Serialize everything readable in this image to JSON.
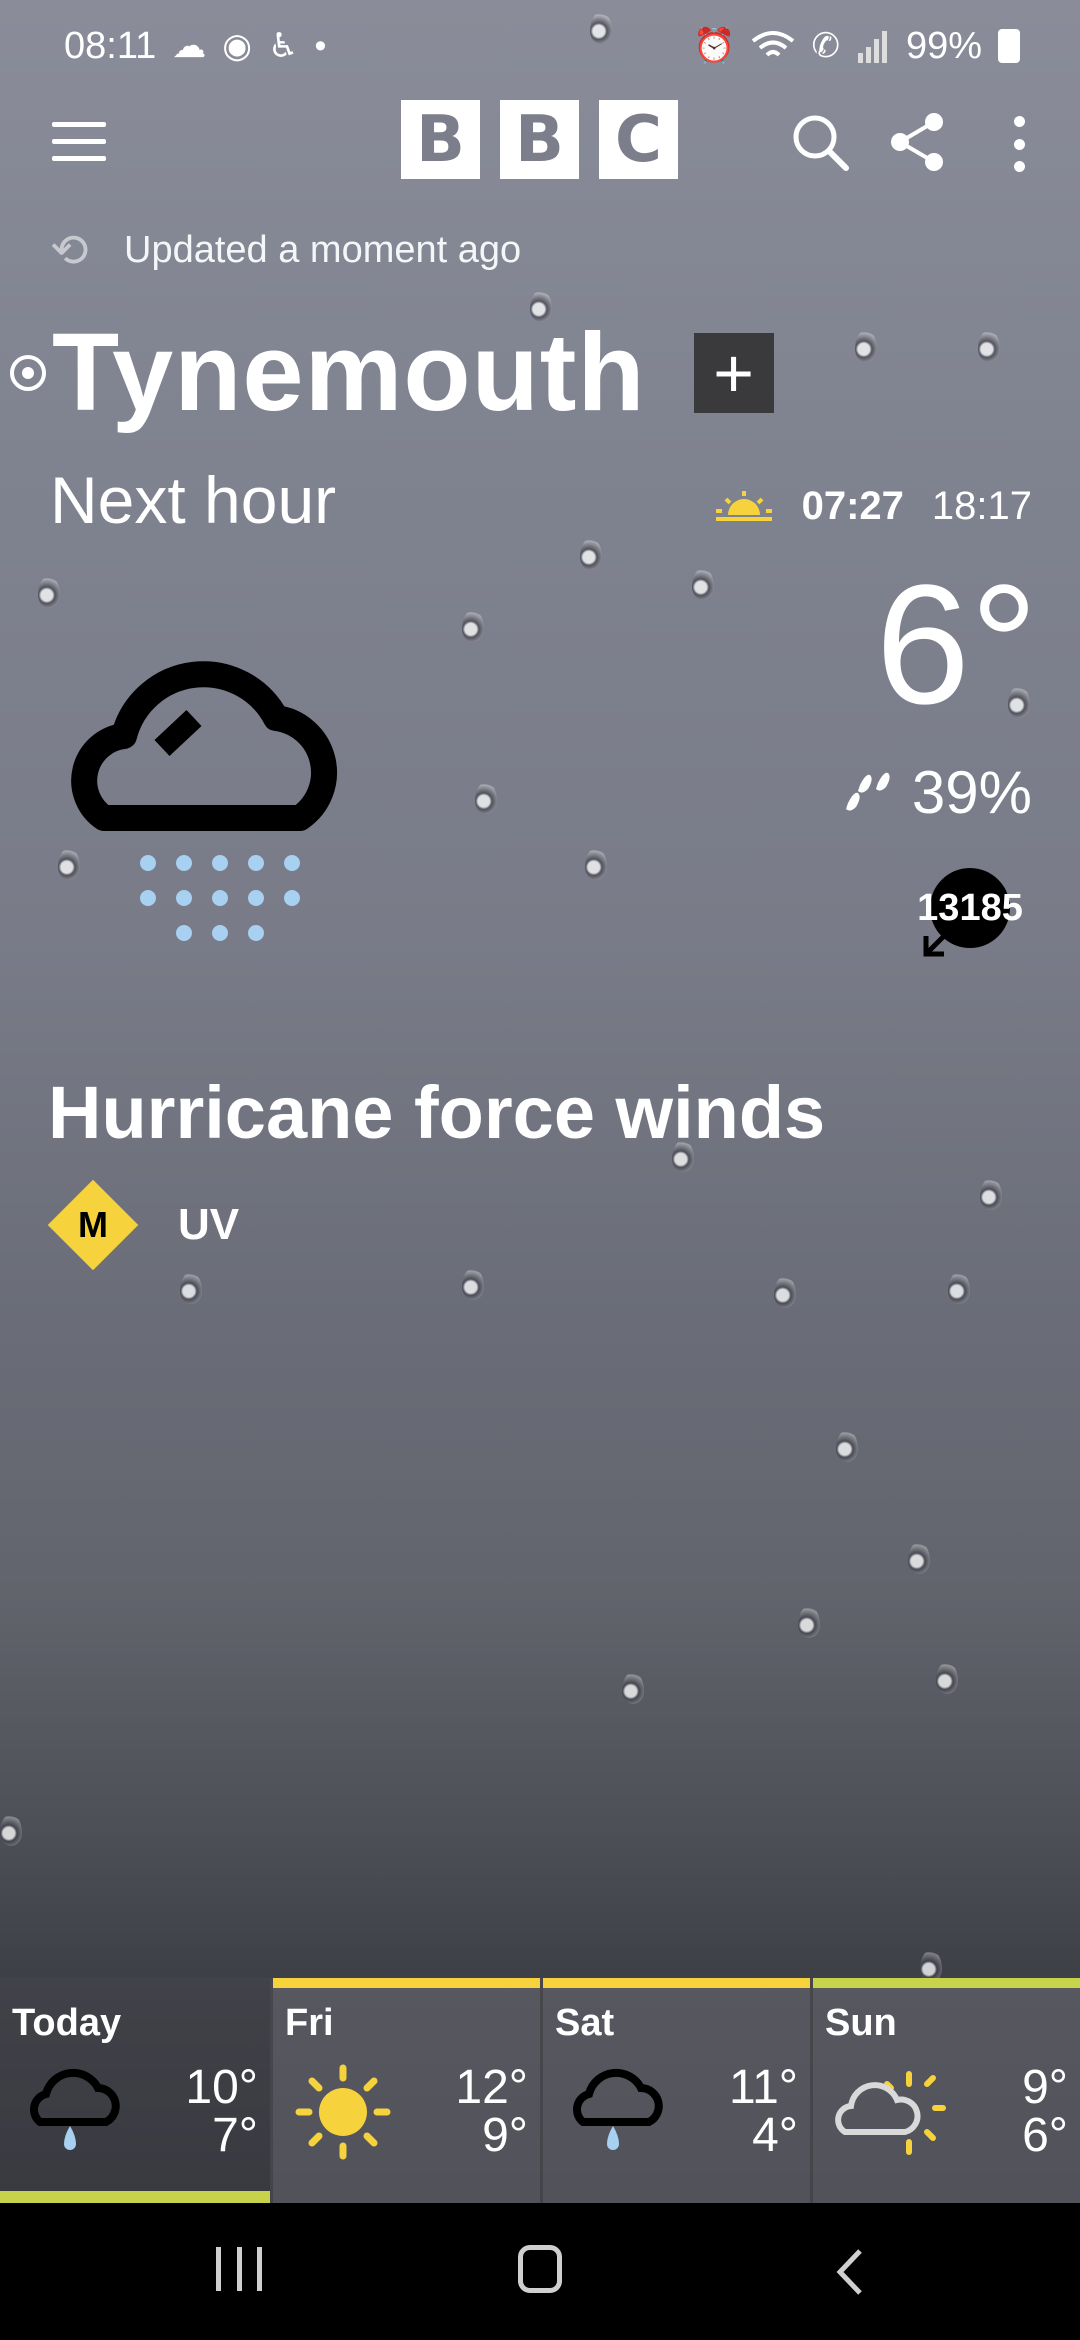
{
  "status_bar": {
    "time": "08:11",
    "battery": "99%",
    "left_icons": [
      "cloud-icon",
      "media-icon",
      "accessibility-icon",
      "dot-icon"
    ],
    "right_icons": [
      "alarm-icon",
      "wifi-icon",
      "wifi-calling-icon",
      "signal-icon",
      "battery-icon"
    ]
  },
  "app_bar": {
    "logo_letters": [
      "B",
      "B",
      "C"
    ]
  },
  "updated": {
    "text": "Updated a moment ago"
  },
  "location": {
    "name": "Tynemouth",
    "add_symbol": "+"
  },
  "next_hour": {
    "label": "Next hour",
    "sunrise": "07:27",
    "sunset": "18:17"
  },
  "current": {
    "temperature": "6°",
    "precipitation": "39%",
    "wind_value": "13185",
    "description": "Hurricane force winds",
    "uv_level": "M",
    "uv_label": "UV"
  },
  "forecast": [
    {
      "day": "Today",
      "high": "10°",
      "low": "7°",
      "icon": "cloud-rain-icon"
    },
    {
      "day": "Fri",
      "high": "12°",
      "low": "9°",
      "icon": "sun-icon"
    },
    {
      "day": "Sat",
      "high": "11°",
      "low": "4°",
      "icon": "cloud-rain-icon"
    },
    {
      "day": "Sun",
      "high": "9°",
      "low": "6°",
      "icon": "sun-cloud-icon"
    }
  ],
  "colors": {
    "accent_yellow": "#f6d23c",
    "today_bar": "#c7d34a",
    "rain_dots": "#a7d0f1"
  }
}
